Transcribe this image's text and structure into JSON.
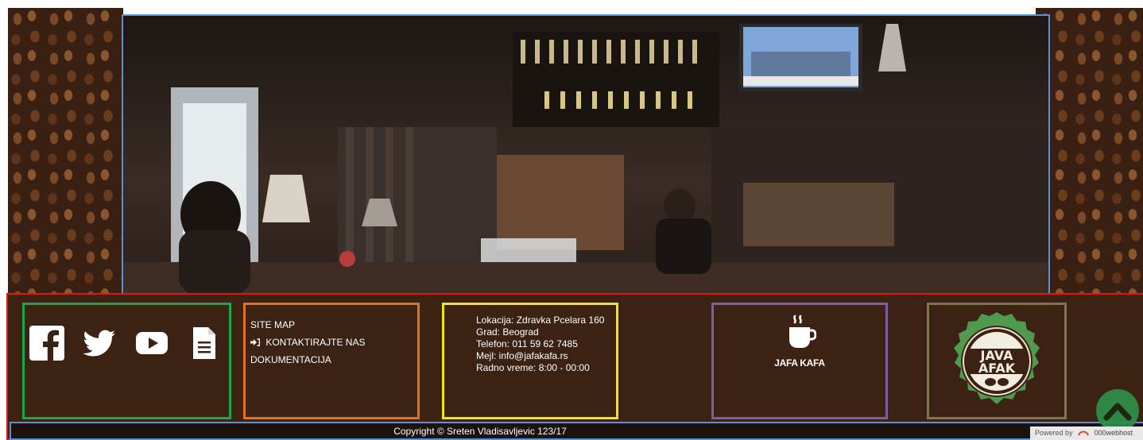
{
  "colors": {
    "footer_bg": "#3b2213",
    "footer_border": "#e01515",
    "hero_border": "#5b8fd6",
    "social_box": "#19a84a",
    "links_box": "#e0731c",
    "info_box": "#f4e21a",
    "brand_box": "#7b5fa6",
    "logo_box": "#807550",
    "scroll_top_button": "#2f8f4a"
  },
  "hero": {
    "image": "cafe-interior-photo"
  },
  "social": {
    "icons": [
      "facebook-icon",
      "twitter-icon",
      "youtube-icon",
      "document-icon"
    ]
  },
  "links": {
    "site_map": "SITE MAP",
    "contact": "KONTAKTIRAJTE NAS",
    "contact_icon": "login-arrow-icon",
    "documentation": "DOKUMENTACIJA"
  },
  "info": {
    "location": "Lokacija: Zdravka Pcelara 160",
    "city": "Grad: Beograd",
    "phone": "Telefon: 011 59 62 7485",
    "email": "Mejl: info@jafakafa.rs",
    "hours": "Radno vreme: 8:00 - 00:00"
  },
  "brand": {
    "icon": "coffee-cup-icon",
    "name": "JAFA KAFA"
  },
  "logo": {
    "text_top": "JAVA",
    "text_bottom": "AFAK"
  },
  "footer": {
    "copyright": "Copyright © Sreten Vladisavljevic 123/17"
  },
  "scroll_top": {
    "icon": "chevron-up-icon"
  },
  "powered_by": {
    "label": "Powered by",
    "host": "000webhost"
  }
}
